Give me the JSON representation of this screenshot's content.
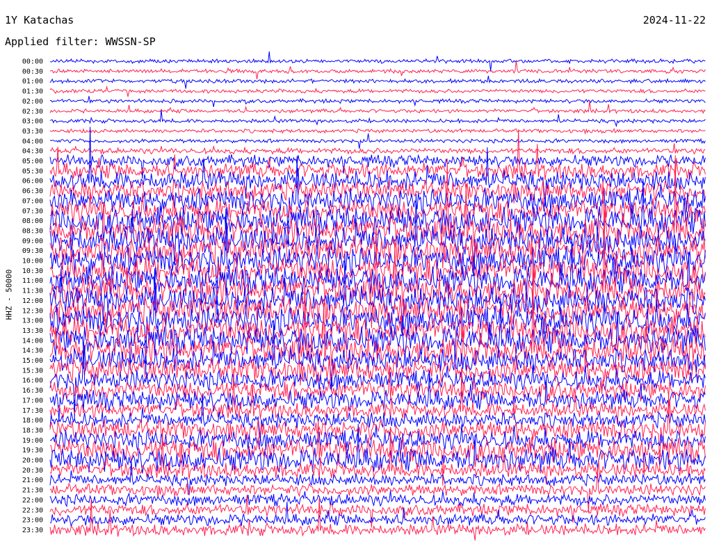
{
  "header": {
    "station": "1Y Katachas",
    "date": "2024-11-22",
    "filter": "Applied filter: WWSSN-SP"
  },
  "chart_data": {
    "type": "line",
    "title": "1Y Katachas",
    "ylabel": "HHZ - 50000",
    "colors": [
      "#0000ff",
      "#ff2050"
    ],
    "hour_labels": [
      "00:00",
      "00:30",
      "01:00",
      "01:30",
      "02:00",
      "02:30",
      "03:00",
      "03:30",
      "04:00",
      "04:30",
      "05:00",
      "05:30",
      "06:00",
      "06:30",
      "07:00",
      "07:30",
      "08:00",
      "08:30",
      "09:00",
      "09:30",
      "10:00",
      "10:30",
      "11:00",
      "11:30",
      "12:00",
      "12:30",
      "13:00",
      "13:30",
      "14:00",
      "14:30",
      "15:00",
      "15:30",
      "16:00",
      "16:30",
      "17:00",
      "17:30",
      "18:00",
      "18:30",
      "19:00",
      "19:30",
      "20:00",
      "20:30",
      "21:00",
      "21:30",
      "22:00",
      "22:30",
      "23:00",
      "23:30"
    ],
    "trace_intensity": [
      1,
      1,
      1,
      1,
      1,
      1,
      1,
      1,
      1,
      1.5,
      3,
      4,
      5,
      5,
      6,
      6,
      7,
      7,
      7,
      7,
      7,
      7,
      7,
      7,
      7,
      7,
      7,
      7,
      7,
      7,
      6,
      6,
      5,
      5,
      5,
      4,
      4,
      5,
      5,
      6,
      6,
      4,
      3,
      3,
      3,
      3,
      3,
      3
    ]
  }
}
